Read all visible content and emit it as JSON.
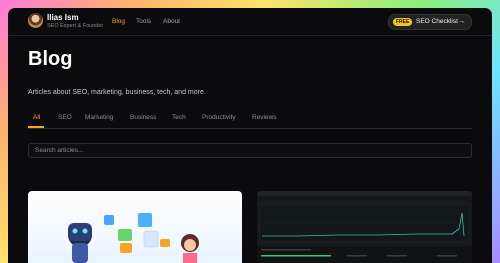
{
  "header": {
    "brand_name": "Ilias Ism",
    "brand_subtitle": "SEO Expert & Founder",
    "nav": [
      {
        "label": "Blog",
        "active": true
      },
      {
        "label": "Tools",
        "active": false
      },
      {
        "label": "About",
        "active": false
      }
    ],
    "cta": {
      "badge": "FREE",
      "label": "SEO Checklist"
    }
  },
  "main": {
    "title": "Blog",
    "subtitle": "Articles about SEO, marketing, business, tech, and more.",
    "tabs": [
      {
        "label": "All",
        "active": true
      },
      {
        "label": "SEO",
        "active": false
      },
      {
        "label": "Marketing",
        "active": false
      },
      {
        "label": "Business",
        "active": false
      },
      {
        "label": "Tech",
        "active": false
      },
      {
        "label": "Productivity",
        "active": false
      },
      {
        "label": "Reviews",
        "active": false
      }
    ],
    "search": {
      "placeholder": "Search articles..."
    }
  },
  "cards": [
    {
      "image": "robot-seo-illustration"
    },
    {
      "image": "analytics-dashboard-screenshot"
    }
  ],
  "colors": {
    "accent": "#f5a524",
    "background": "#0b0b0d",
    "badge": "#f5c518"
  }
}
